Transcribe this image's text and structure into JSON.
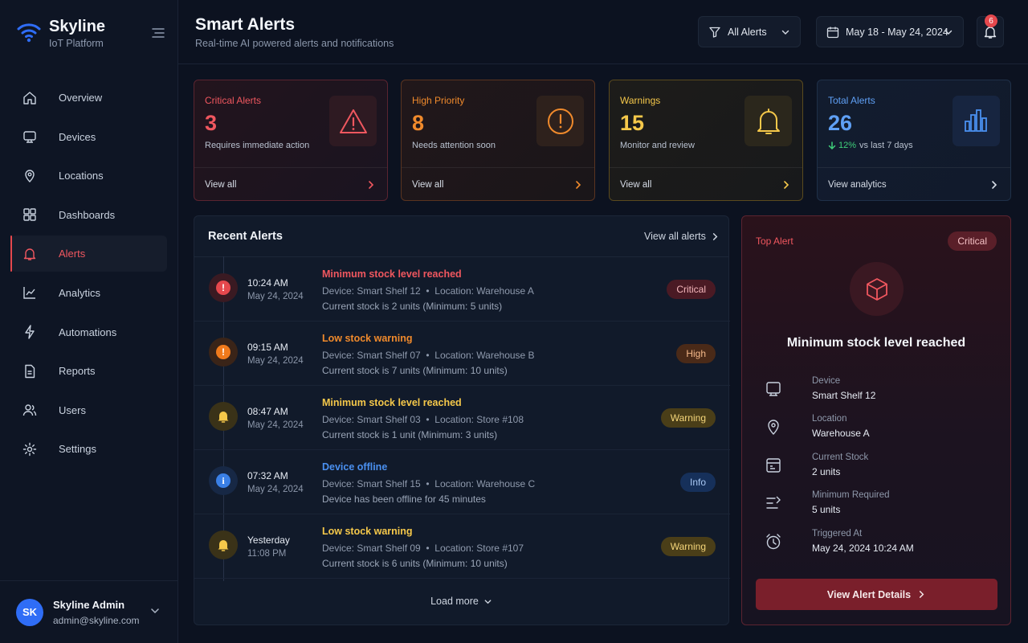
{
  "brand": {
    "title": "Skyline",
    "subtitle": "IoT Platform"
  },
  "nav": {
    "items": [
      {
        "label": "Overview",
        "icon": "home-icon"
      },
      {
        "label": "Devices",
        "icon": "device-icon"
      },
      {
        "label": "Locations",
        "icon": "map-pin-icon"
      },
      {
        "label": "Dashboards",
        "icon": "grid-icon"
      },
      {
        "label": "Alerts",
        "icon": "bell-icon",
        "active": true
      },
      {
        "label": "Analytics",
        "icon": "chart-icon"
      },
      {
        "label": "Automations",
        "icon": "lightning-icon"
      },
      {
        "label": "Reports",
        "icon": "document-icon"
      },
      {
        "label": "Users",
        "icon": "users-icon"
      },
      {
        "label": "Settings",
        "icon": "gear-icon"
      }
    ]
  },
  "user": {
    "initials": "SK",
    "name": "Skyline Admin",
    "email": "admin@skyline.com"
  },
  "header": {
    "title": "Smart Alerts",
    "subtitle": "Real-time AI powered alerts and notifications",
    "filter_label": "All Alerts",
    "date_range": "May 18 - May 24, 2024",
    "notification_count": "6"
  },
  "cards": {
    "critical": {
      "label": "Critical Alerts",
      "value": "3",
      "desc": "Requires immediate action",
      "footer": "View all"
    },
    "high": {
      "label": "High Priority",
      "value": "8",
      "desc": "Needs attention soon",
      "footer": "View all"
    },
    "warnings": {
      "label": "Warnings",
      "value": "15",
      "desc": "Monitor and review",
      "footer": "View all"
    },
    "total": {
      "label": "Total Alerts",
      "value": "26",
      "trend": "12%",
      "trend_suffix": "vs last 7 days",
      "footer": "View analytics"
    }
  },
  "recent": {
    "title": "Recent Alerts",
    "view_all": "View all alerts",
    "load_more": "Load more",
    "alerts": [
      {
        "time": "10:24 AM",
        "date": "May 24, 2024",
        "title": "Minimum stock level reached",
        "device": "Device: Smart Shelf 12",
        "location": "Location: Warehouse A",
        "detail": "Current stock is 2 units (Minimum: 5 units)",
        "severity": "Critical"
      },
      {
        "time": "09:15 AM",
        "date": "May 24, 2024",
        "title": "Low stock warning",
        "device": "Device: Smart Shelf 07",
        "location": "Location: Warehouse B",
        "detail": "Current stock is 7 units (Minimum: 10 units)",
        "severity": "High"
      },
      {
        "time": "08:47 AM",
        "date": "May 24, 2024",
        "title": "Minimum stock level reached",
        "device": "Device: Smart Shelf 03",
        "location": "Location: Store #108",
        "detail": "Current stock is 1 unit (Minimum: 3 units)",
        "severity": "Warning"
      },
      {
        "time": "07:32 AM",
        "date": "May 24, 2024",
        "title": "Device offline",
        "device": "Device: Smart Shelf 15",
        "location": "Location: Warehouse C",
        "detail": "Device has been offline for 45 minutes",
        "severity": "Info"
      },
      {
        "time": "Yesterday",
        "date": "11:08 PM",
        "title": "Low stock warning",
        "device": "Device: Smart Shelf 09",
        "location": "Location: Store #107",
        "detail": "Current stock is 6 units (Minimum: 10 units)",
        "severity": "Warning"
      }
    ]
  },
  "top_alert": {
    "label": "Top Alert",
    "severity": "Critical",
    "title": "Minimum stock level reached",
    "fields": [
      {
        "key": "Device",
        "value": "Smart Shelf 12"
      },
      {
        "key": "Location",
        "value": "Warehouse A"
      },
      {
        "key": "Current Stock",
        "value": "2 units"
      },
      {
        "key": "Minimum Required",
        "value": "5 units"
      },
      {
        "key": "Triggered At",
        "value": "May 24, 2024 10:24 AM"
      }
    ],
    "button": "View Alert Details"
  },
  "colors": {
    "critical": "#f0575f",
    "high": "#f08a2c",
    "warning": "#f5c84a",
    "info": "#4a90f0",
    "accent": "#2f6df6"
  }
}
